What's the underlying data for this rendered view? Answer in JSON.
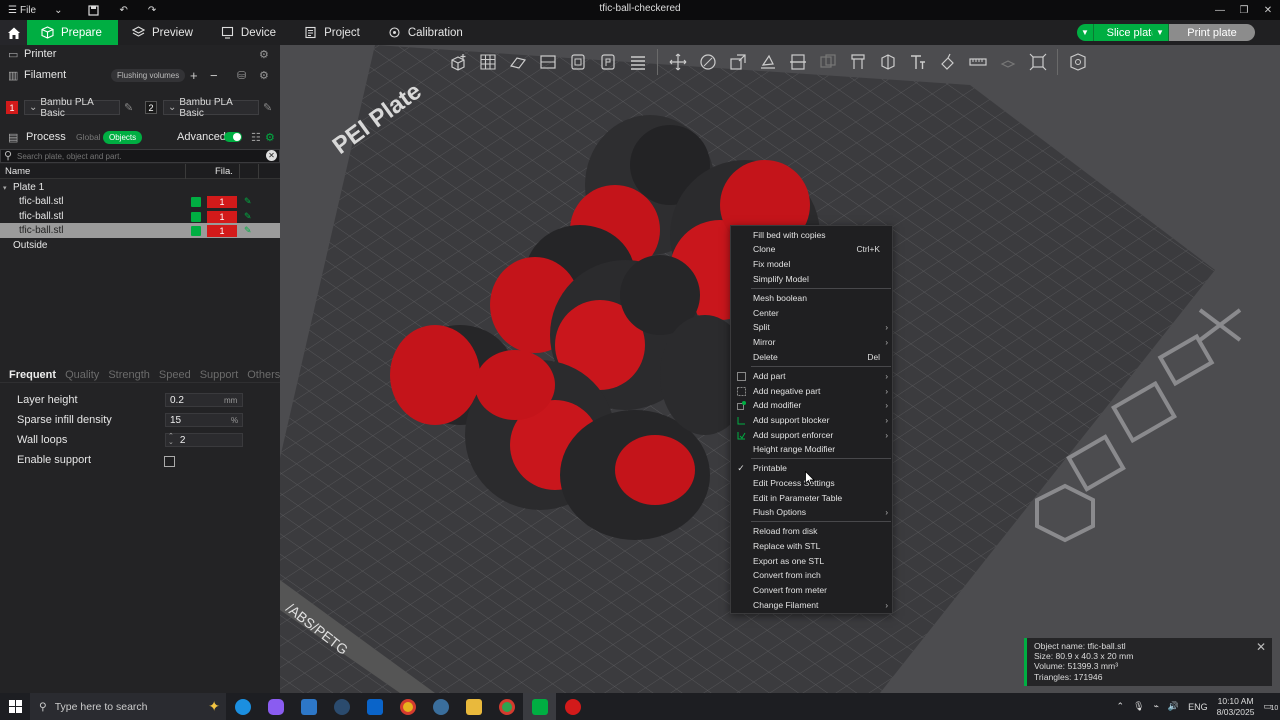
{
  "window": {
    "title": "tfic-ball-checkered",
    "file_menu": "File"
  },
  "colors": {
    "accent": "#00ae42",
    "filament_red": "#d21a1a",
    "panel_bg": "#232325"
  },
  "nav": {
    "tabs": [
      {
        "label": "Prepare",
        "icon": "cube-icon"
      },
      {
        "label": "Preview",
        "icon": "layers-icon"
      },
      {
        "label": "Device",
        "icon": "device-icon"
      },
      {
        "label": "Project",
        "icon": "project-icon"
      },
      {
        "label": "Calibration",
        "icon": "calibration-icon"
      }
    ],
    "active_tab": "Prepare",
    "slice_label": "Slice plate",
    "print_label": "Print plate"
  },
  "sidebar": {
    "printer_label": "Printer",
    "filament_label": "Filament",
    "flushing_volumes": "Flushing volumes",
    "filaments": [
      {
        "num": "1",
        "name": "Bambu PLA Basic",
        "color": "#d21a1a"
      },
      {
        "num": "2",
        "name": "Bambu PLA Basic",
        "color": "#1a1a1a"
      }
    ],
    "process_label": "Process",
    "global_label": "Global",
    "objects_label": "Objects",
    "advanced_label": "Advanced",
    "search_placeholder": "Search plate, object and part.",
    "columns": {
      "name": "Name",
      "fila": "Fila."
    },
    "plate_label": "Plate 1",
    "objects": [
      {
        "name": "tfic-ball.stl",
        "fila": "1",
        "selected": false
      },
      {
        "name": "tfic-ball.stl",
        "fila": "1",
        "selected": false
      },
      {
        "name": "tfic-ball.stl",
        "fila": "1",
        "selected": true
      }
    ],
    "outside_label": "Outside"
  },
  "settings": {
    "tabs": [
      "Frequent",
      "Quality",
      "Strength",
      "Speed",
      "Support",
      "Others"
    ],
    "active_tab": "Frequent",
    "params": {
      "layer_height": {
        "label": "Layer height",
        "value": "0.2",
        "unit": "mm"
      },
      "sparse_infill": {
        "label": "Sparse infill density",
        "value": "15",
        "unit": "%"
      },
      "wall_loops": {
        "label": "Wall loops",
        "value": "2"
      },
      "enable_support": {
        "label": "Enable support",
        "checked": false
      }
    }
  },
  "plate": {
    "brand_text": "PEI Plate",
    "material_text": "/ABS/PETG"
  },
  "context_menu": {
    "items": [
      {
        "label": "Fill bed with copies"
      },
      {
        "label": "Clone",
        "shortcut": "Ctrl+K"
      },
      {
        "label": "Fix model"
      },
      {
        "label": "Simplify Model"
      },
      {
        "label": "Mesh boolean"
      },
      {
        "label": "Center"
      },
      {
        "label": "Split",
        "submenu": true
      },
      {
        "label": "Mirror",
        "submenu": true
      },
      {
        "label": "Delete",
        "shortcut": "Del"
      },
      {
        "label": "Add part",
        "submenu": true
      },
      {
        "label": "Add negative part",
        "submenu": true
      },
      {
        "label": "Add modifier",
        "submenu": true
      },
      {
        "label": "Add support blocker",
        "submenu": true
      },
      {
        "label": "Add support enforcer",
        "submenu": true
      },
      {
        "label": "Height range Modifier"
      },
      {
        "label": "Printable",
        "checked": true
      },
      {
        "label": "Edit Process Settings"
      },
      {
        "label": "Edit in Parameter Table"
      },
      {
        "label": "Flush Options",
        "submenu": true
      },
      {
        "label": "Reload from disk"
      },
      {
        "label": "Replace with STL"
      },
      {
        "label": "Export as one STL"
      },
      {
        "label": "Convert from inch"
      },
      {
        "label": "Convert from meter"
      },
      {
        "label": "Change Filament",
        "submenu": true
      }
    ]
  },
  "object_info": {
    "name": "Object name: tfic-ball.stl",
    "size": "Size: 80.9 x 40.3 x 20 mm",
    "volume": "Volume: 51399.3 mm³",
    "triangles": "Triangles: 171946"
  },
  "taskbar": {
    "search_placeholder": "Type here to search",
    "lang": "ENG",
    "time": "10:10 AM",
    "date": "8/03/2025",
    "notifications": "10"
  }
}
